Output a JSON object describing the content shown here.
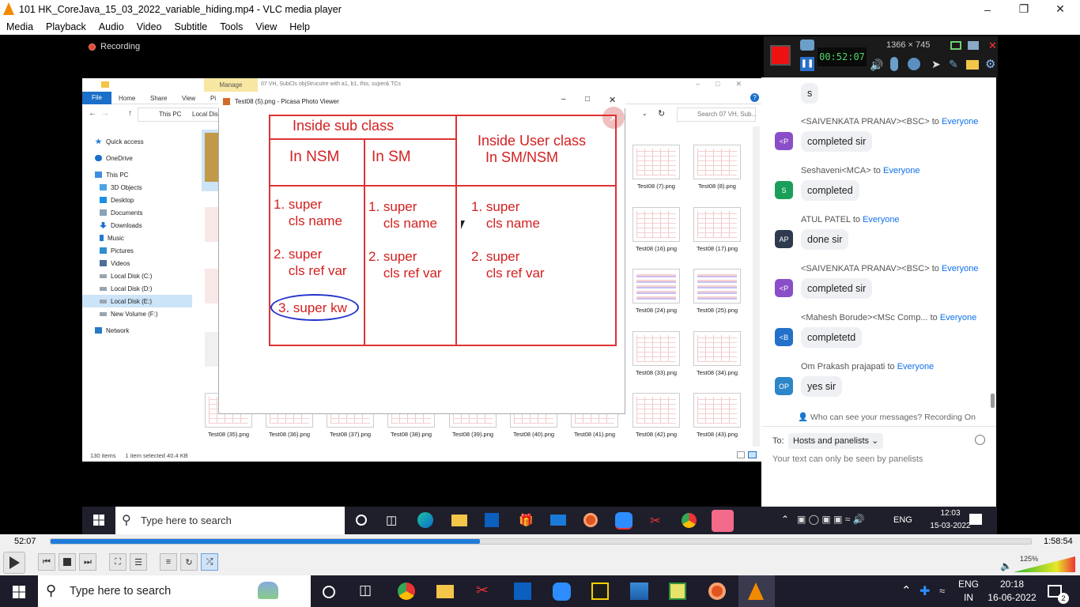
{
  "window": {
    "title": "101 HK_CoreJava_15_03_2022_variable_hiding.mp4 - VLC media player"
  },
  "menu": [
    "Media",
    "Playback",
    "Audio",
    "Video",
    "Subtitle",
    "Tools",
    "View",
    "Help"
  ],
  "recording_label": "Recording",
  "zoom_panel": {
    "resolution": "1366 × 745",
    "timer": "00:52:07"
  },
  "explorer": {
    "manage_tab": "Manage",
    "title": "07 VH, SubCls objStrucutre with a1, b1, this, super& TCs",
    "ribbon": [
      "File",
      "Home",
      "Share",
      "View",
      "Pi"
    ],
    "address": [
      "This PC",
      "Local Dis"
    ],
    "search_placeholder": "Search 07 VH, Sub...",
    "nav": [
      "Quick access",
      "OneDrive",
      "This PC",
      "3D Objects",
      "Desktop",
      "Documents",
      "Downloads",
      "Music",
      "Pictures",
      "Videos",
      "Local Disk (C:)",
      "Local Disk (D:)",
      "Local Disk (E:)",
      "New Volume (F:)",
      "Network"
    ],
    "thumbs_right": [
      "Test08 (7).png",
      "Test08 (8).png",
      "Test08 (16).png",
      "Test08 (17).png",
      "Test08 (24).png",
      "Test08 (25).png",
      "Test08 (33).png",
      "Test08 (34).png",
      "Test08 (42).png",
      "Test08 (43).png"
    ],
    "thumbs_bottom": [
      "Test08 (35).png",
      "Test08 (36).png",
      "Test08 (37).png",
      "Test08 (38).png",
      "Test08 (39).png",
      "Test08 (40).png",
      "Test08 (41).png"
    ],
    "status_items": "130 items",
    "status_selected": "1 item selected  40.4 KB"
  },
  "picasa": {
    "title": "Test08 (5).png - Picasa Photo Viewer",
    "h_sub": "Inside sub class",
    "h_user": "Inside User class\n  In SM/NSM",
    "h_nsm": "In NSM",
    "h_sm": "In SM",
    "c1_1": "1. super\n    cls name",
    "c1_2": "2. super\n    cls ref var",
    "c1_3": "3. super kw",
    "c2_1": "1. super\n    cls name",
    "c2_2": "2. super\n    cls ref var",
    "c3_1": "1. super\n    cls name",
    "c3_2": "2. super\n    cls ref var"
  },
  "chat": {
    "messages": [
      {
        "initials": "",
        "from": "",
        "to": "",
        "text": "s",
        "color": ""
      },
      {
        "initials": "<P",
        "from": "<SAIVENKATA PRANAV><BSC>",
        "to": "Everyone",
        "text": "completed sir",
        "color": "#8a4fc8"
      },
      {
        "initials": "S",
        "from": "Seshaveni<MCA>",
        "to": "Everyone",
        "text": "completed",
        "color": "#1a9f5a"
      },
      {
        "initials": "AP",
        "from": "ATUL PATEL",
        "to": "Everyone",
        "text": "done sir",
        "color": "#2d3a4f"
      },
      {
        "initials": "<P",
        "from": "<SAIVENKATA PRANAV><BSC>",
        "to": "Everyone",
        "text": "completed sir",
        "color": "#8a4fc8"
      },
      {
        "initials": "<B",
        "from": "<Mahesh Borude><MSc Comp...",
        "to": "Everyone",
        "text": "completetd",
        "color": "#2371c9"
      },
      {
        "initials": "OP",
        "from": "Om Prakash prajapati",
        "to": "Everyone",
        "text": "yes sir",
        "color": "#2d86c8"
      }
    ],
    "to_word": "to",
    "who_can_see": "Who can see your messages? Recording On",
    "to_label": "To:",
    "recipient": "Hosts and panelists",
    "input_placeholder": "Your text can only be seen by panelists"
  },
  "inner_taskbar": {
    "search": "Type here to search",
    "lang": "ENG",
    "time": "12:03",
    "date": "15-03-2022"
  },
  "player": {
    "elapsed": "52:07",
    "total": "1:58:54",
    "progress": 0.438,
    "volume": "125%"
  },
  "taskbar": {
    "search": "Type here to search",
    "lang": "ENG",
    "region": "IN",
    "time": "20:18",
    "date": "16-06-2022",
    "notif": "2"
  }
}
